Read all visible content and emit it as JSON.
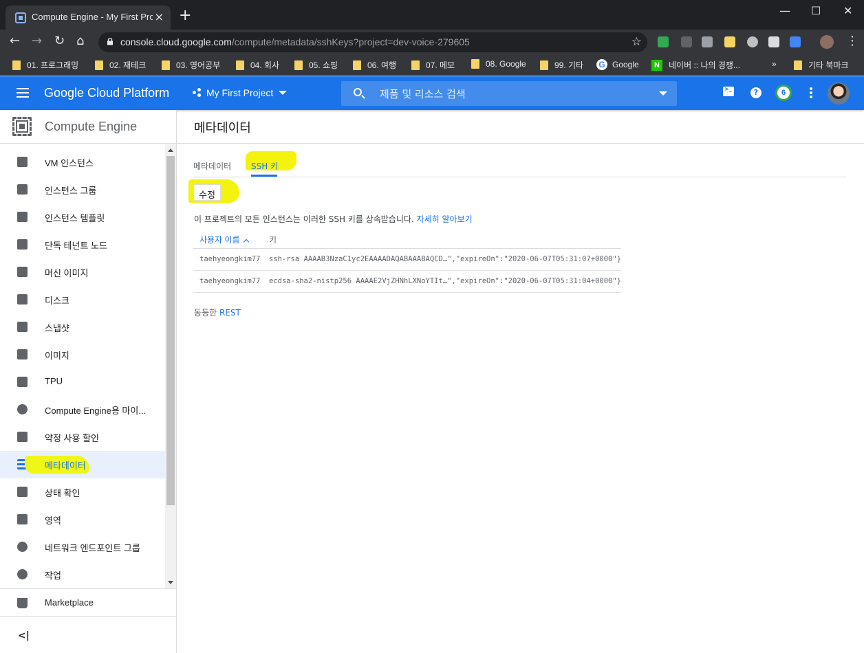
{
  "browser": {
    "tab_title": "Compute Engine - My First Proj",
    "tab_close": "×",
    "new_tab": "+",
    "url_host": "console.cloud.google.com",
    "url_path": "/compute/metadata/sshKeys?project=dev-voice-279605",
    "win_min": "—",
    "win_max": "☐",
    "win_close": "✕"
  },
  "bookmarks": [
    {
      "label": "01. 프로그래밍"
    },
    {
      "label": "02. 재테크"
    },
    {
      "label": "03. 영어공부"
    },
    {
      "label": "04. 회사"
    },
    {
      "label": "05. 쇼핑"
    },
    {
      "label": "06. 여행"
    },
    {
      "label": "07. 메모"
    },
    {
      "label": "08. Google"
    },
    {
      "label": "99. 기타"
    },
    {
      "label": "Google"
    },
    {
      "label": "네이버 :: 나의 경쟁..."
    },
    {
      "label": "기타 북마크"
    }
  ],
  "bookmarks_more": "»",
  "header": {
    "brand": "Google Cloud Platform",
    "project": "My First Project",
    "search_placeholder": "제품 및 리소스 검색",
    "notifications": "6"
  },
  "sidebar": {
    "title": "Compute Engine",
    "items": [
      {
        "label": "VM 인스턴스"
      },
      {
        "label": "인스턴스 그룹"
      },
      {
        "label": "인스턴스 템플릿"
      },
      {
        "label": "단독 테넌트 노드"
      },
      {
        "label": "머신 이미지"
      },
      {
        "label": "디스크"
      },
      {
        "label": "스냅샷"
      },
      {
        "label": "이미지"
      },
      {
        "label": "TPU"
      },
      {
        "label": "Compute Engine용 마이..."
      },
      {
        "label": "약정 사용 할인"
      },
      {
        "label": "메타데이터"
      },
      {
        "label": "상태 확인"
      },
      {
        "label": "영역"
      },
      {
        "label": "네트워크 엔드포인트 그룹"
      },
      {
        "label": "작업"
      }
    ],
    "marketplace": "Marketplace",
    "collapse": "<|"
  },
  "main": {
    "title": "메타데이터",
    "tabs": [
      {
        "label": "메타데이터"
      },
      {
        "label": "SSH 키"
      }
    ],
    "edit_button": "수정",
    "description": "이 프로젝트의 모든 인스턴스는 이러한 SSH 키를 상속받습니다.",
    "learn_more": "자세히 알아보기",
    "table": {
      "headers": [
        "사용자 이름",
        "키"
      ],
      "rows": [
        {
          "user": "taehyeongkim77",
          "key": "ssh-rsa AAAAB3NzaC1yc2EAAAADAQABAAABAQCD…\",\"expireOn\":\"2020-06-07T05:31:07+0000\"}"
        },
        {
          "user": "taehyeongkim77",
          "key": "ecdsa-sha2-nistp256 AAAAE2VjZHNhLXNoYTIt…\",\"expireOn\":\"2020-06-07T05:31:04+0000\"}"
        }
      ]
    },
    "rest_prefix": "동등한",
    "rest_link": "REST"
  },
  "colors": {
    "gcp_blue": "#1a73e8",
    "highlight": "#f3f30d",
    "browser_dark": "#202124"
  }
}
